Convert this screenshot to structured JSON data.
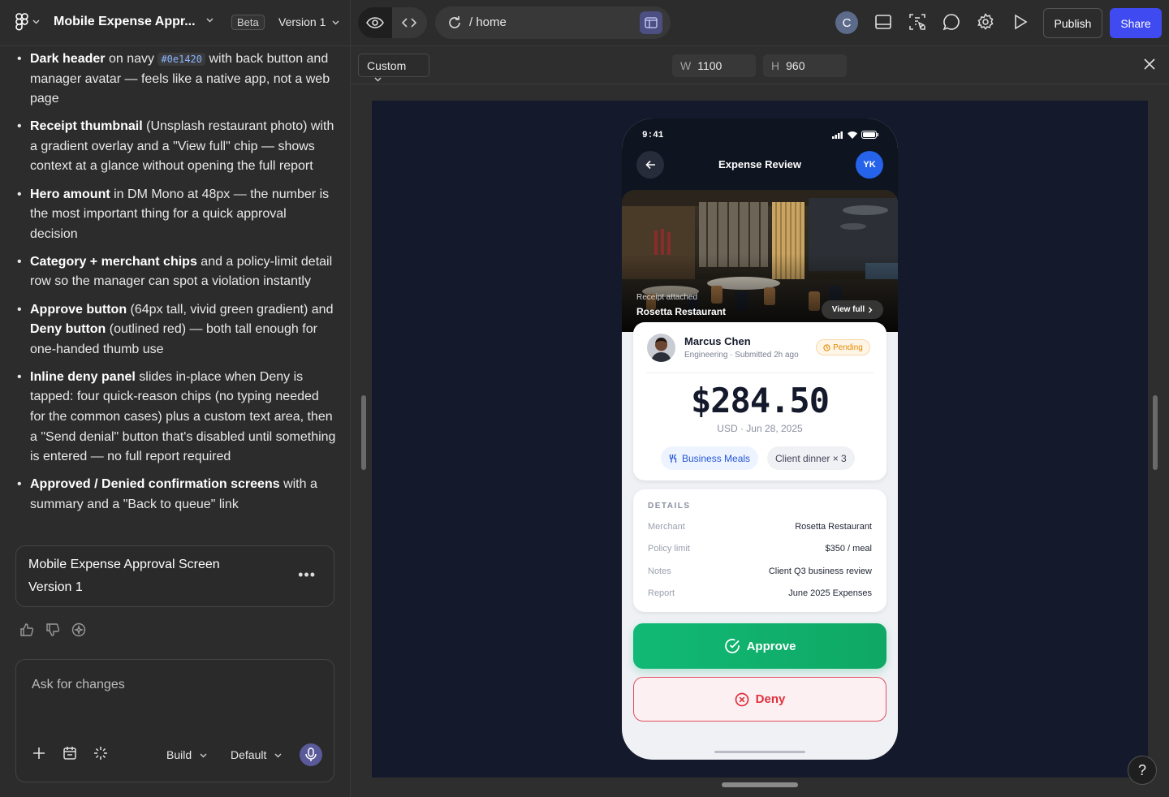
{
  "topbar": {
    "project_title": "Mobile Expense Appr...",
    "beta_label": "Beta",
    "version_label": "Version 1",
    "url_path": "/  home",
    "avatar_initial": "C",
    "publish_label": "Publish",
    "share_label": "Share"
  },
  "notes": [
    {
      "bold": "Dark header",
      "t1": " on navy ",
      "code": "#0e1420",
      "t2": " with back button and manager avatar — feels like a native app, not a web page"
    },
    {
      "bold": "Receipt thumbnail",
      "t1": " (Unsplash restaurant photo) with a gradient overlay and a \"View full\" chip — shows context at a glance without opening the full report"
    },
    {
      "bold": "Hero amount",
      "t1": " in DM Mono at 48px — the number is the most important thing for a quick approval decision"
    },
    {
      "bold": "Category + merchant chips",
      "t1": " and a policy-limit detail row so the manager can spot a violation instantly"
    },
    {
      "bold": "Approve button",
      "t1": " (64px tall, vivid green gradient) and ",
      "bold2": "Deny button",
      "t2": " (outlined red) — both tall enough for one-handed thumb use"
    },
    {
      "bold": "Inline deny panel",
      "t1": " slides in-place when Deny is tapped: four quick-reason chips (no typing needed for the common cases) plus a custom text area, then a \"Send denial\" button that's disabled until something is entered — no full report required"
    },
    {
      "bold": "Approved / Denied confirmation screens",
      "t1": " with a summary and a \"Back to queue\" link"
    }
  ],
  "version_card": {
    "title": "Mobile Expense Approval Screen",
    "subtitle": "Version 1"
  },
  "chat": {
    "placeholder": "Ask for changes",
    "mode_label": "Build",
    "model_label": "Default"
  },
  "canvas": {
    "device_label": "Custom",
    "width_label": "W",
    "width_value": "1100",
    "height_label": "H",
    "height_value": "960"
  },
  "phone": {
    "time": "9:41",
    "title": "Expense Review",
    "manager_initials": "YK",
    "receipt_caption": "Receipt attached",
    "receipt_merchant": "Rosetta Restaurant",
    "view_full_label": "View full",
    "employee_name": "Marcus Chen",
    "employee_meta": "Engineering · Submitted 2h ago",
    "status": "Pending",
    "amount": "$284.50",
    "amount_meta": "USD · Jun 28, 2025",
    "category_chip": "Business Meals",
    "merchant_chip": "Client dinner × 3",
    "details_heading": "DETAILS",
    "details": [
      {
        "label": "Merchant",
        "value": "Rosetta Restaurant"
      },
      {
        "label": "Policy limit",
        "value": "$350 / meal"
      },
      {
        "label": "Notes",
        "value": "Client Q3 business review"
      },
      {
        "label": "Report",
        "value": "June 2025 Expenses"
      }
    ],
    "approve_label": "Approve",
    "deny_label": "Deny"
  },
  "colors": {
    "header_navy": "#0e1420",
    "accent_blue": "#3f4bf0",
    "approve_green": "#10b975",
    "deny_red": "#e0303e",
    "pending_orange": "#e08a00"
  },
  "help_label": "?"
}
